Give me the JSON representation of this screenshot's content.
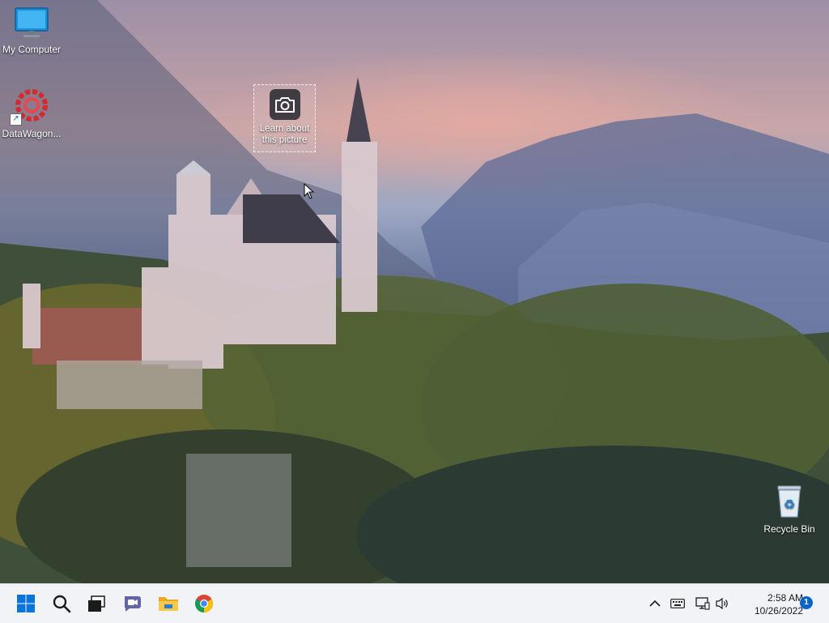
{
  "desktop": {
    "icons": [
      {
        "name": "my-computer",
        "label": "My Computer",
        "icon": "monitor-icon"
      },
      {
        "name": "datawagon",
        "label": "DataWagon...",
        "icon": "datawagon-gear-icon",
        "shortcut": true
      },
      {
        "name": "recycle-bin",
        "label": "Recycle Bin",
        "icon": "recycle-bin-icon"
      }
    ],
    "spotlight": {
      "label": "Learn about this picture",
      "icon": "camera-icon"
    },
    "wallpaper": "castle-mountain-landscape"
  },
  "taskbar": {
    "apps": [
      {
        "name": "start",
        "icon": "windows-start-icon",
        "color": "#0a74da"
      },
      {
        "name": "search",
        "icon": "search-icon"
      },
      {
        "name": "task-view",
        "icon": "task-view-icon"
      },
      {
        "name": "chat",
        "icon": "teams-chat-icon",
        "color": "#6264a7"
      },
      {
        "name": "file-explorer",
        "icon": "folder-icon",
        "color": "#f3c13a"
      },
      {
        "name": "chrome",
        "icon": "chrome-icon"
      }
    ],
    "tray": {
      "icons": [
        "chevron-up-icon",
        "keyboard-icon",
        "network-icon",
        "speaker-icon"
      ],
      "time": "2:58 AM",
      "date": "10/26/2022",
      "notification_count": "1"
    }
  }
}
